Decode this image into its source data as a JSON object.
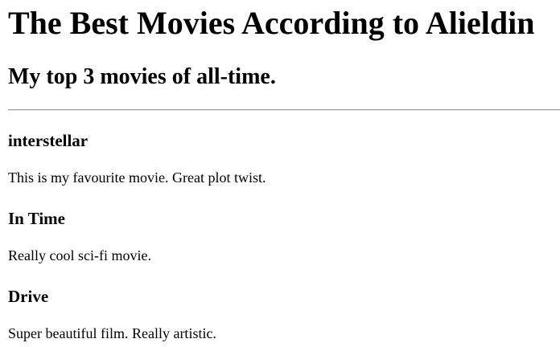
{
  "page": {
    "title": "The Best Movies According to Alieldin",
    "subtitle": "My top 3 movies of all-time."
  },
  "movies": [
    {
      "name": "interstellar",
      "description": "This is my favourite movie. Great plot twist."
    },
    {
      "name": "In Time",
      "description": "Really cool sci-fi movie."
    },
    {
      "name": "Drive",
      "description": "Super beautiful film. Really artistic."
    }
  ]
}
